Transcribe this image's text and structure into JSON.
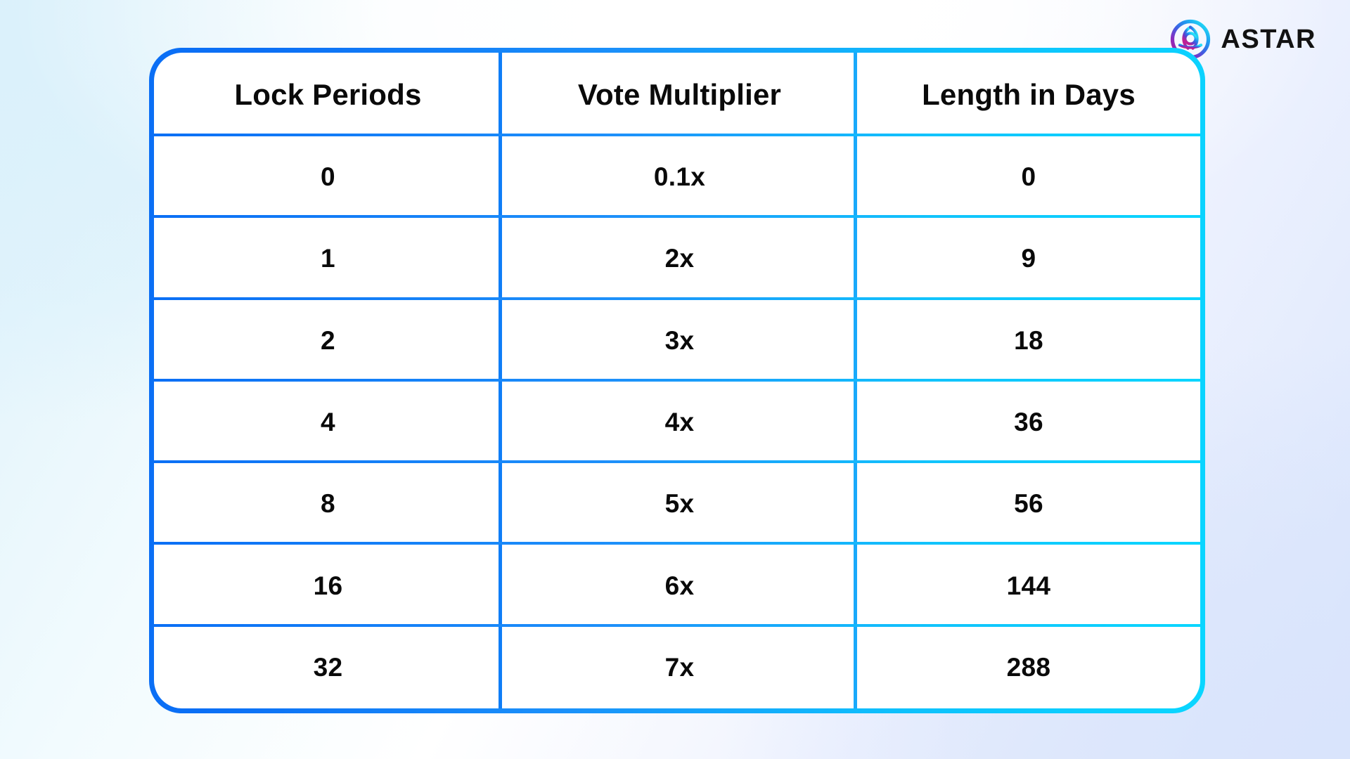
{
  "brand": {
    "name": "ASTAR",
    "logo_icon": "astar-knot-logo-icon",
    "logo_gradient_from": "#9b2fae",
    "logo_gradient_mid": "#2f6fe0",
    "logo_gradient_to": "#22d3ee"
  },
  "theme": {
    "border_gradient_from": "#0b6ff5",
    "border_gradient_to": "#0ad6ff",
    "divider_col1": "#0f7ef7",
    "divider_col2": "#19a9fb",
    "text_color": "#0a0a0a",
    "table_background": "#ffffff",
    "page_background_from": "#ddf1fa",
    "page_background_to": "#dbe6fc"
  },
  "table": {
    "headers": [
      "Lock Periods",
      "Vote Multiplier",
      "Length in Days"
    ],
    "rows": [
      {
        "lock_period": "0",
        "vote_multiplier": "0.1x",
        "length_in_days": "0"
      },
      {
        "lock_period": "1",
        "vote_multiplier": "2x",
        "length_in_days": "9"
      },
      {
        "lock_period": "2",
        "vote_multiplier": "3x",
        "length_in_days": "18"
      },
      {
        "lock_period": "4",
        "vote_multiplier": "4x",
        "length_in_days": "36"
      },
      {
        "lock_period": "8",
        "vote_multiplier": "5x",
        "length_in_days": "56"
      },
      {
        "lock_period": "16",
        "vote_multiplier": "6x",
        "length_in_days": "144"
      },
      {
        "lock_period": "32",
        "vote_multiplier": "7x",
        "length_in_days": "288"
      }
    ]
  }
}
